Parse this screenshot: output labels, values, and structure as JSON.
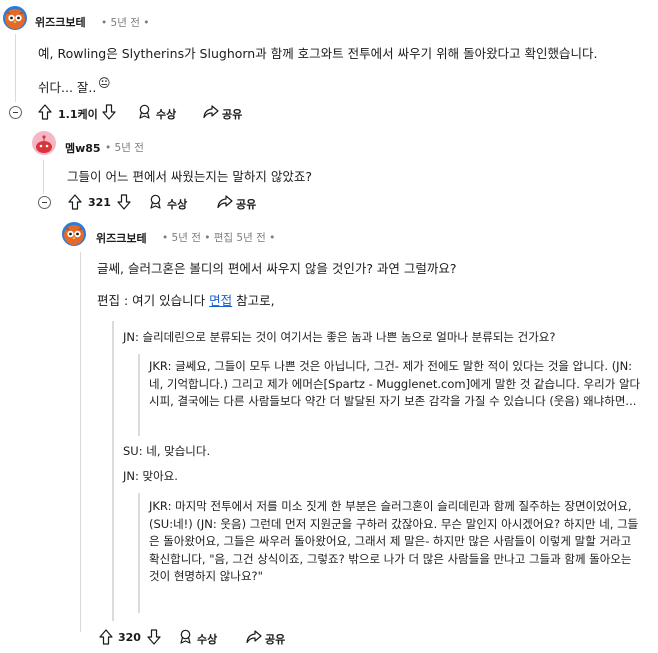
{
  "comments": [
    {
      "author": "위즈크보테",
      "time": "• 5년 전 •",
      "body": [
        "예, Rowling은 Slytherins가 Slughorn과 함께 호그와트 전투에서 싸우기 위해 돌아왔다고 확인했습니다.",
        "쉬다... 잘.."
      ],
      "emoji": "😐",
      "votes": "1.1케이",
      "award_label": "수상",
      "share_label": "공유"
    },
    {
      "author": "멤w85",
      "time": "• 5년 전",
      "body": "그들이 어느 편에서 싸웠는지는 말하지 않았죠?",
      "votes": "321",
      "award_label": "수상",
      "share_label": "공유"
    },
    {
      "author": "위즈크보테",
      "time": "• 5년 전 • 편집 5년 전 •",
      "body_line1": "글쎄, 슬러그혼은 볼디의 편에서 싸우지 않을 것인가? 과연 그럴까요?",
      "body_line2_prefix": "편집 : 여기 있습니다 ",
      "body_line2_link": "면접",
      "body_line2_suffix": " 참고로,",
      "quote_jn1": "JN: 슬리데린으로 분류되는 것이 여기서는 좋은 놈과 나쁜 놈으로 얼마나 분류되는 건가요?",
      "quote_jkr1": "JKR: 글쎄요, 그들이 모두 나쁜 것은 아닙니다, 그건- 제가 전에도 말한 적이 있다는 것을 압니다. (JN: 네, 기억합니다.) 그리고 제가 에머슨[Spartz - Mugglenet.com]에게 말한 것 같습니다. 우리가 알다시피, 결국에는 다른 사람들보다 약간 더 발달된 자기 보존 감각을 가질 수 있습니다 (웃음) 왜냐하면...",
      "quote_su": "SU: 네, 맞습니다.",
      "quote_jn2": "JN: 맞아요.",
      "quote_jkr2": "JKR: 마지막 전투에서 저를 미소 짓게 한 부분은 슬러그혼이 슬리데린과 함께 질주하는 장면이었어요, (SU:네!) (JN: 웃음) 그런데 먼저 지원군을 구하러 갔잖아요. 무슨 말인지 아시겠어요? 하지만 네, 그들은 돌아왔어요, 그들은 싸우러 돌아왔어요, 그래서 제 말은- 하지만 많은 사람들이 이렇게 말할 거라고 확신합니다, \"음, 그건 상식이죠, 그렇죠? 밖으로 나가 더 많은 사람들을 만나고 그들과 함께 돌아오는 것이 현명하지 않나요?\"",
      "votes": "320",
      "award_label": "수상",
      "share_label": "공유"
    }
  ],
  "colors": {
    "link": "#1a5fd1",
    "meta": "#7c7c7c",
    "thread_line": "#dadada"
  },
  "icons": [
    "upvote-icon",
    "downvote-icon",
    "award-icon",
    "share-icon",
    "collapse-icon",
    "owl-avatar",
    "snoo-avatar"
  ]
}
